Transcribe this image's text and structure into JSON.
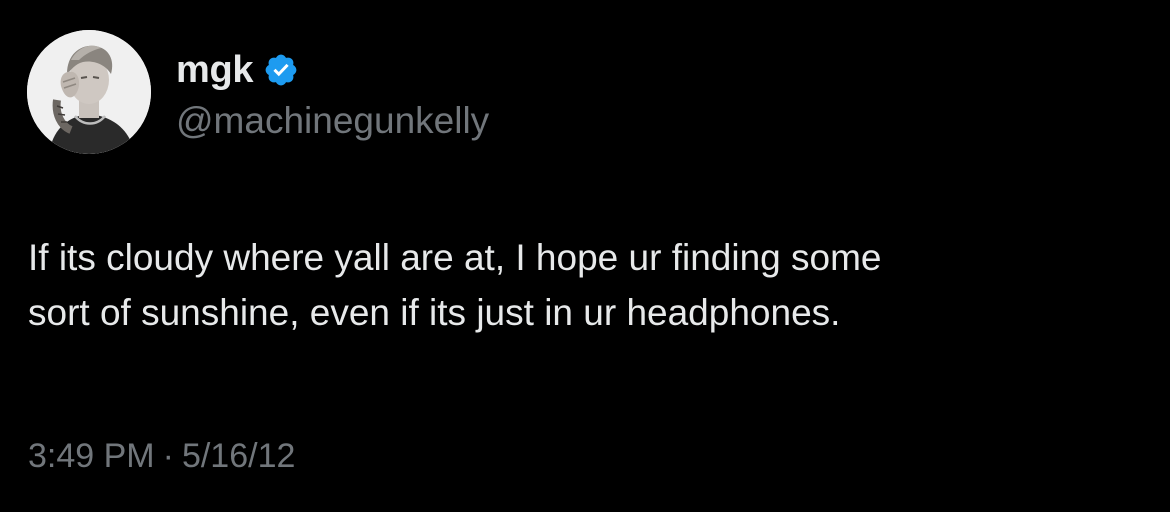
{
  "author": {
    "display_name": "mgk",
    "handle": "@machinegunkelly",
    "verified": true,
    "verified_color": "#1d9bf0",
    "avatar_icon": "profile-photo"
  },
  "tweet": {
    "text_lines": [
      "If its cloudy where yall are at, I hope ur finding some",
      "sort of sunshine, even if its just in ur headphones."
    ]
  },
  "meta": {
    "time": "3:49 PM",
    "separator": "·",
    "date": "5/16/12"
  },
  "colors": {
    "background": "#000000",
    "primary_text": "#e7e9ea",
    "secondary_text": "#71767b"
  }
}
